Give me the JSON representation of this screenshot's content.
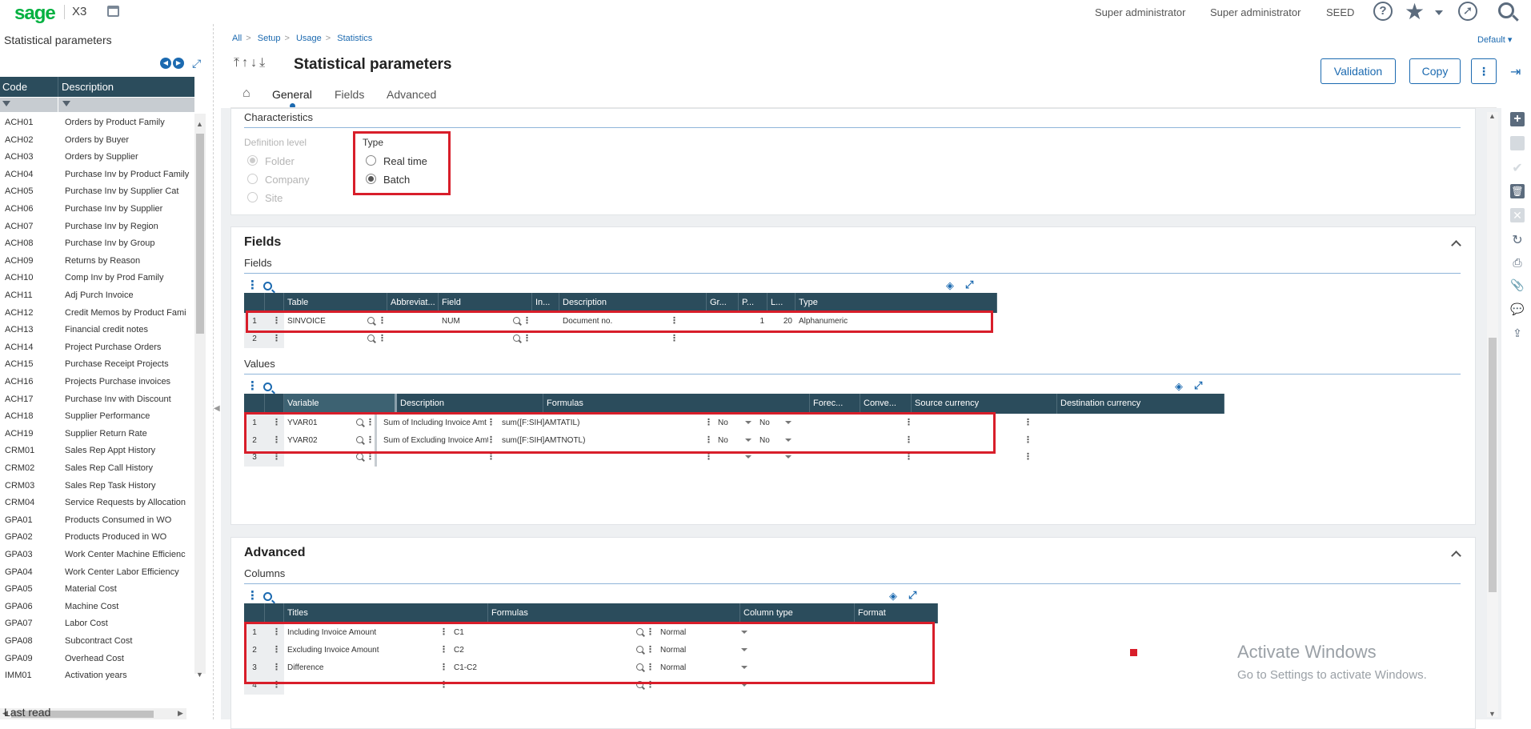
{
  "app": {
    "logo": "sage",
    "product": "X3"
  },
  "topbar": {
    "user1": "Super administrator",
    "user2": "Super administrator",
    "folder": "SEED",
    "help_icon": "?"
  },
  "left_panel": {
    "title": "Statistical parameters",
    "columns": [
      "Code",
      "Description"
    ],
    "rows": [
      [
        "ACH01",
        "Orders by Product Family"
      ],
      [
        "ACH02",
        "Orders by Buyer"
      ],
      [
        "ACH03",
        "Orders by Supplier"
      ],
      [
        "ACH04",
        "Purchase Inv by Product Family"
      ],
      [
        "ACH05",
        "Purchase Inv by Supplier Cat"
      ],
      [
        "ACH06",
        "Purchase Inv by Supplier"
      ],
      [
        "ACH07",
        "Purchase Inv by Region"
      ],
      [
        "ACH08",
        "Purchase Inv by Group"
      ],
      [
        "ACH09",
        "Returns by Reason"
      ],
      [
        "ACH10",
        "Comp Inv by Prod Family"
      ],
      [
        "ACH11",
        "Adj Purch Invoice"
      ],
      [
        "ACH12",
        "Credit Memos by Product Fami"
      ],
      [
        "ACH13",
        "Financial credit notes"
      ],
      [
        "ACH14",
        "Project Purchase Orders"
      ],
      [
        "ACH15",
        "Purchase Receipt Projects"
      ],
      [
        "ACH16",
        "Projects Purchase invoices"
      ],
      [
        "ACH17",
        "Purchase Inv with Discount"
      ],
      [
        "ACH18",
        "Supplier Performance"
      ],
      [
        "ACH19",
        "Supplier Return Rate"
      ],
      [
        "CRM01",
        "Sales Rep Appt History"
      ],
      [
        "CRM02",
        "Sales Rep Call History"
      ],
      [
        "CRM03",
        "Sales Rep Task History"
      ],
      [
        "CRM04",
        "Service Requests by Allocation"
      ],
      [
        "GPA01",
        "Products Consumed in WO"
      ],
      [
        "GPA02",
        "Products Produced in WO"
      ],
      [
        "GPA03",
        "Work Center Machine Efficienc"
      ],
      [
        "GPA04",
        "Work Center Labor Efficiency"
      ],
      [
        "GPA05",
        "Material Cost"
      ],
      [
        "GPA06",
        "Machine Cost"
      ],
      [
        "GPA07",
        "Labor Cost"
      ],
      [
        "GPA08",
        "Subcontract Cost"
      ],
      [
        "GPA09",
        "Overhead Cost"
      ],
      [
        "IMM01",
        "Activation years"
      ]
    ],
    "footer": "Last read"
  },
  "breadcrumb": [
    "All",
    "Setup",
    "Usage",
    "Statistics"
  ],
  "default_selector": "Default",
  "page_title": "Statistical parameters",
  "buttons": {
    "validation": "Validation",
    "copy": "Copy"
  },
  "tabs": [
    "General",
    "Fields",
    "Advanced"
  ],
  "characteristics": {
    "title": "Characteristics",
    "definition_level_label": "Definition level",
    "definition_levels": [
      "Folder",
      "Company",
      "Site"
    ],
    "type_label": "Type",
    "types": [
      "Real time",
      "Batch"
    ]
  },
  "fields_section": {
    "title": "Fields",
    "subtitle": "Fields",
    "columns": [
      "Table",
      "Abbreviat...",
      "Field",
      "In...",
      "Description",
      "Gr...",
      "P...",
      "L...",
      "Type"
    ],
    "rows": [
      {
        "n": "1",
        "table": "SINVOICE",
        "field": "NUM",
        "description": "Document no.",
        "p": "1",
        "l": "20",
        "type": "Alphanumeric"
      },
      {
        "n": "2",
        "table": "",
        "field": "",
        "description": "",
        "p": "",
        "l": "",
        "type": ""
      }
    ]
  },
  "values_section": {
    "subtitle": "Values",
    "columns": [
      "Variable",
      "Description",
      "Formulas",
      "Forec...",
      "Conve...",
      "Source currency",
      "Destination currency"
    ],
    "rows": [
      {
        "n": "1",
        "variable": "YVAR01",
        "description": "Sum of Including Invoice Amt",
        "formula": "sum([F:SIH]AMTATIL)",
        "forecast": "No",
        "convert": "No"
      },
      {
        "n": "2",
        "variable": "YVAR02",
        "description": "Sum of Excluding Invoice Amt",
        "formula": "sum([F:SIH]AMTNOTL)",
        "forecast": "No",
        "convert": "No"
      },
      {
        "n": "3",
        "variable": "",
        "description": "",
        "formula": "",
        "forecast": "",
        "convert": ""
      }
    ]
  },
  "advanced_section": {
    "title": "Advanced",
    "subtitle": "Columns",
    "columns": [
      "Titles",
      "Formulas",
      "Column type",
      "Format"
    ],
    "rows": [
      {
        "n": "1",
        "title": "Including Invoice Amount",
        "formula": "C1",
        "type": "Normal"
      },
      {
        "n": "2",
        "title": "Excluding Invoice Amount",
        "formula": "C2",
        "type": "Normal"
      },
      {
        "n": "3",
        "title": "Difference",
        "formula": "C1-C2",
        "type": "Normal"
      },
      {
        "n": "4",
        "title": "",
        "formula": "",
        "type": ""
      }
    ]
  },
  "watermark": {
    "line1": "Activate Windows",
    "line2": "Go to Settings to activate Windows."
  },
  "colors": {
    "accent": "#1c6ab0",
    "brand": "#00b140",
    "header": "#2b4c5c",
    "highlight": "#d81e2a"
  }
}
